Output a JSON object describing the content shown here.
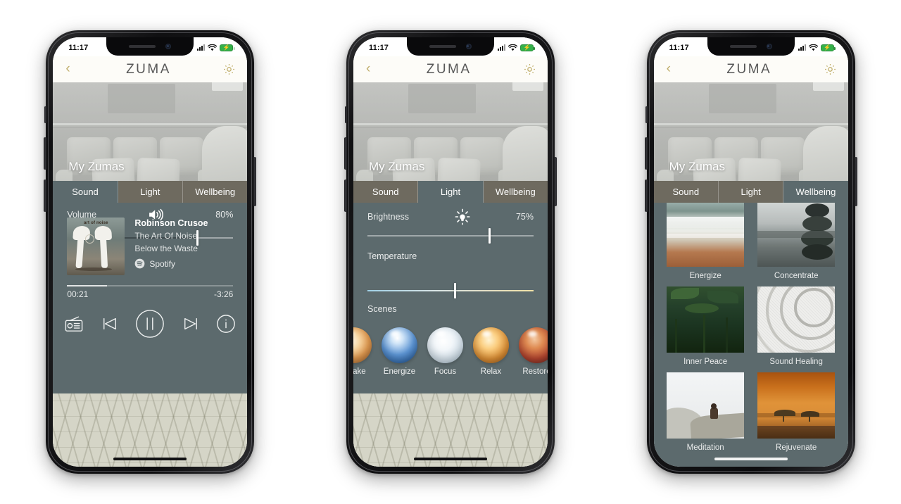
{
  "meta": {
    "background": "#ffffff",
    "accent": "#c0ae6b",
    "panel_bg": "#5c6a6d",
    "tab_inactive_bg": "#6e6a5f"
  },
  "status": {
    "time": "11:17",
    "signal": "cellular-signal-icon",
    "wifi": "wifi-icon",
    "battery": "battery-charging-icon"
  },
  "appbar": {
    "back": "‹",
    "brand": "ZUMA",
    "settings": "gear-icon"
  },
  "hero": {
    "title": "My Zumas"
  },
  "tabs": [
    {
      "id": "sound",
      "label": "Sound"
    },
    {
      "id": "light",
      "label": "Light"
    },
    {
      "id": "wellbeing",
      "label": "Wellbeing"
    }
  ],
  "phone1": {
    "active_tab": "Sound",
    "volume": {
      "label": "Volume",
      "icon": "speaker-volume-icon",
      "value": "80%",
      "percent": 80
    },
    "now_playing": {
      "album_art_caption": "art of noise",
      "track": "Robinson Crusoe",
      "artist": "The Art Of Noise",
      "album": "Below the Waste",
      "source": "Spotify",
      "source_icon": "spotify-icon",
      "elapsed": "00:21",
      "remaining": "-3:26",
      "progress_percent": 24
    },
    "transport": [
      {
        "id": "radio",
        "icon": "radio-icon"
      },
      {
        "id": "previous",
        "icon": "skip-previous-icon"
      },
      {
        "id": "pause",
        "icon": "pause-icon"
      },
      {
        "id": "next",
        "icon": "skip-next-icon"
      },
      {
        "id": "info",
        "icon": "info-icon"
      }
    ]
  },
  "phone2": {
    "active_tab": "Light",
    "brightness": {
      "label": "Brightness",
      "icon": "lightbulb-icon",
      "value": "75%",
      "percent": 73
    },
    "temperature": {
      "label": "Temperature",
      "percent": 52
    },
    "scenes_label": "Scenes",
    "scenes": [
      {
        "name": "Awake",
        "color_a": "#f7e2c0",
        "color_b": "#d58a45"
      },
      {
        "name": "Energize",
        "color_a": "#bcd9f2",
        "color_b": "#1d5ea8"
      },
      {
        "name": "Focus",
        "color_a": "#ffffff",
        "color_b": "#b9cfdd"
      },
      {
        "name": "Relax",
        "color_a": "#fbd58b",
        "color_b": "#c06a22"
      },
      {
        "name": "Restore",
        "color_a": "#e8a070",
        "color_b": "#7a2a24"
      }
    ]
  },
  "phone3": {
    "active_tab": "Wellbeing",
    "programs": [
      {
        "name": "Energize",
        "image": "beach-surf-photo",
        "c1": "#cfd8d4",
        "c2": "#8d9b8f",
        "c3": "#b5764d"
      },
      {
        "name": "Concentrate",
        "image": "stacked-stones-photo",
        "c1": "#c9cdc9",
        "c2": "#7e8580",
        "c3": "#40474a"
      },
      {
        "name": "Inner Peace",
        "image": "rainforest-photo",
        "c1": "#2f4c30",
        "c2": "#20381f",
        "c3": "#13240f"
      },
      {
        "name": "Sound Healing",
        "image": "zen-sand-rings-photo",
        "c1": "#f0f0ee",
        "c2": "#d9d9d6",
        "c3": "#bdbdb9"
      },
      {
        "name": "Meditation",
        "image": "mountain-meditation-photo",
        "c1": "#eef0f1",
        "c2": "#cfd1cf",
        "c3": "#8f8b80"
      },
      {
        "name": "Rejuvenate",
        "image": "savanna-sunset-photo",
        "c1": "#b35d16",
        "c2": "#e08b3a",
        "c3": "#c96a22"
      }
    ]
  }
}
